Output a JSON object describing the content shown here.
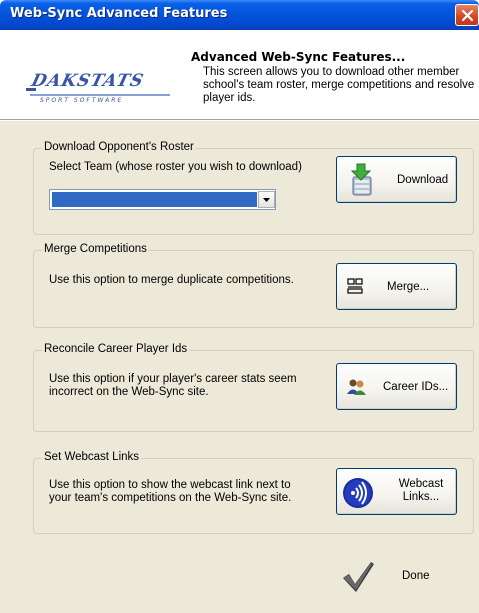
{
  "window": {
    "title": "Web-Sync Advanced Features"
  },
  "header": {
    "logo_text": "DAKSTATS",
    "logo_tagline": "SPORT SOFTWARE",
    "title": "Advanced Web-Sync Features...",
    "description": "This screen allows you to download other member school's team roster, merge competitions and resolve player ids."
  },
  "sections": {
    "download": {
      "label": "Download Opponent's Roster",
      "text": "Select Team (whose roster you wish to download)",
      "select_value": "",
      "button_label": "Download"
    },
    "merge": {
      "label": "Merge Competitions",
      "text": "Use this option to merge duplicate competitions.",
      "button_label": "Merge..."
    },
    "reconcile": {
      "label": "Reconcile Career Player Ids",
      "text_line1": "Use this option if your player's career stats seem",
      "text_line2": "incorrect on the Web-Sync site.",
      "button_label": "Career IDs..."
    },
    "webcast": {
      "label": "Set Webcast Links",
      "text_line1": "Use this option to show the webcast link next to",
      "text_line2": "your team's competitions on the Web-Sync site.",
      "button_label_line1": "Webcast",
      "button_label_line2": "Links..."
    }
  },
  "footer": {
    "done_label": "Done"
  },
  "colors": {
    "titlebar": "#0553db",
    "dialog_bg": "#ece9d8",
    "selection": "#316ac5",
    "close_button": "#d2451f"
  }
}
